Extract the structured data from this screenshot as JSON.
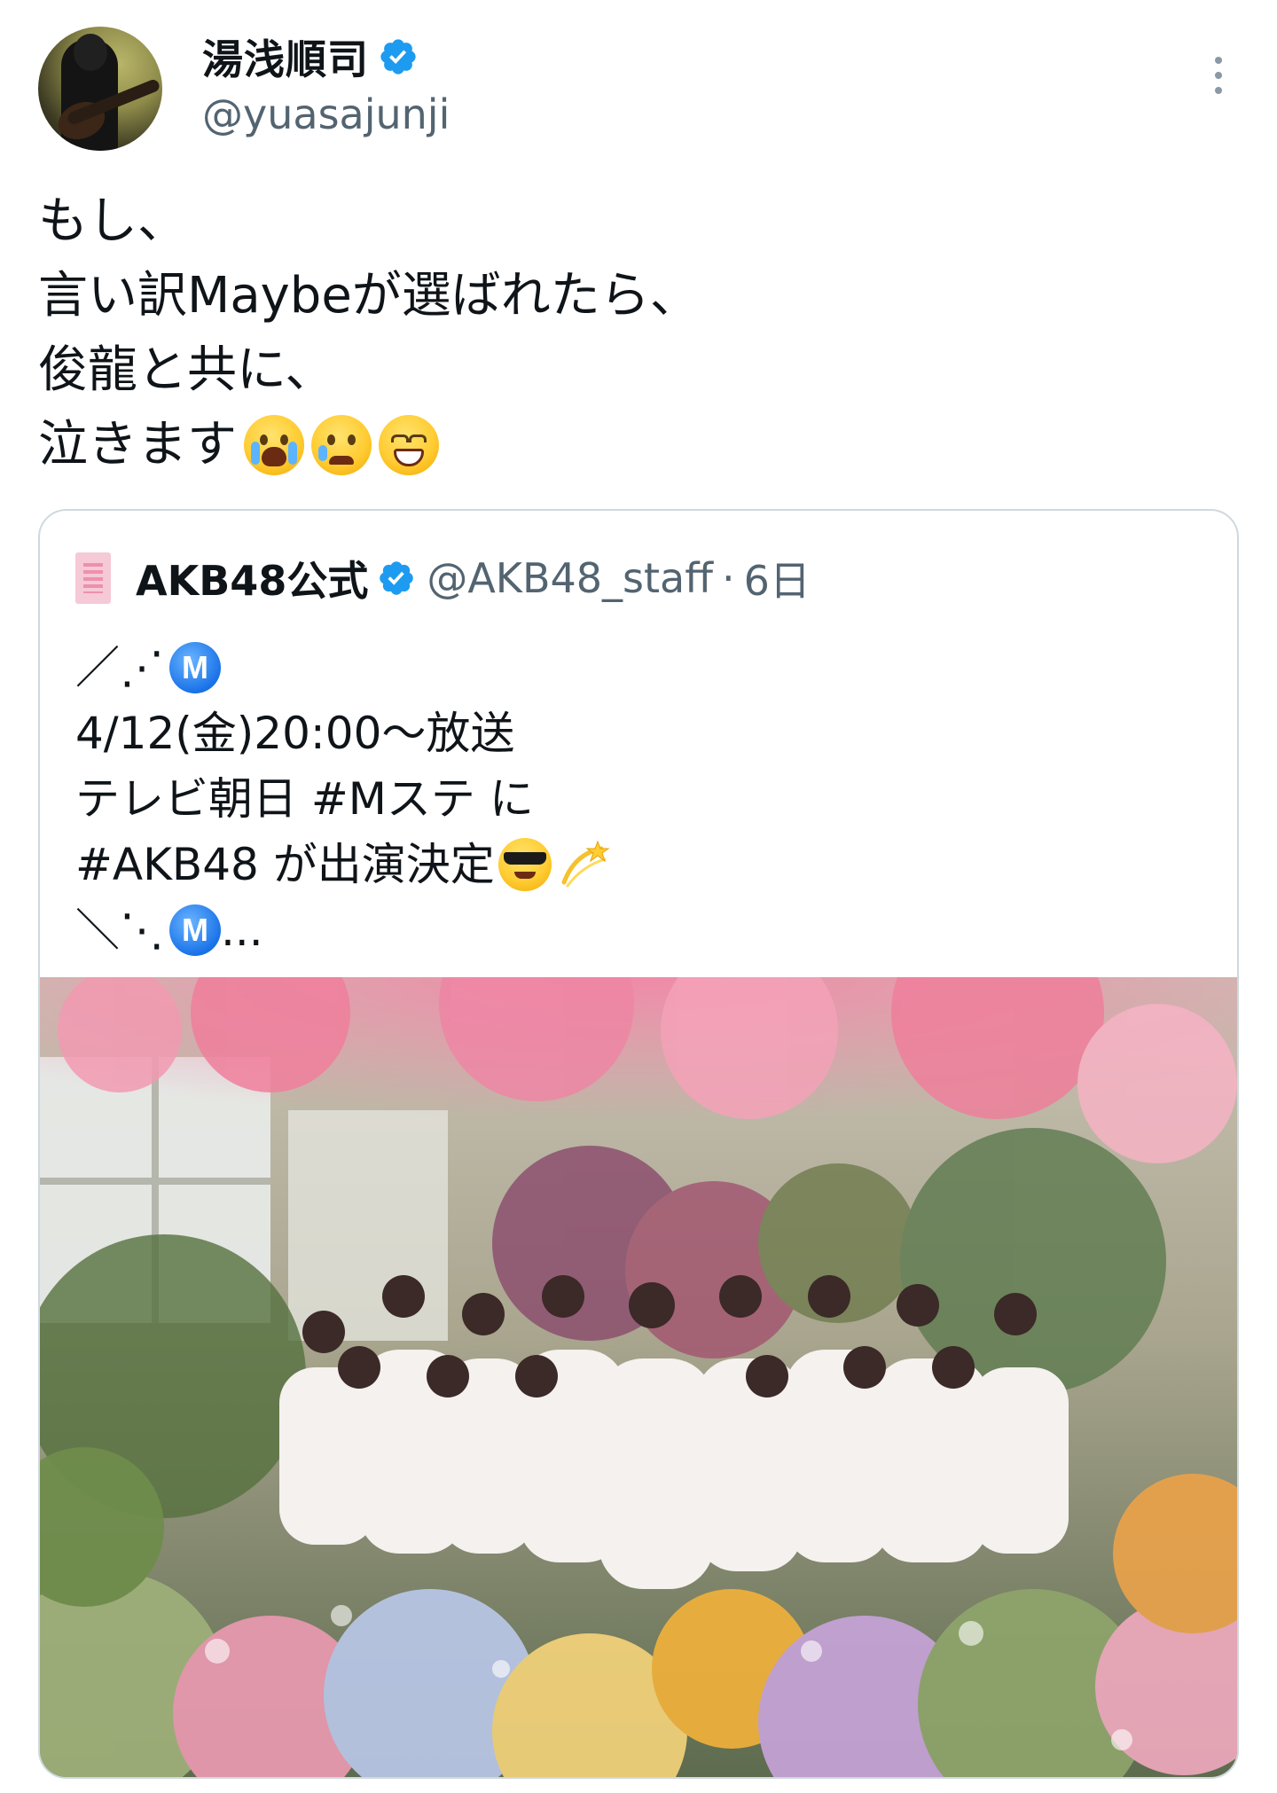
{
  "author": {
    "display_name": "湯浅順司",
    "handle": "@yuasajunji",
    "verified": true,
    "avatar_icon": "avatar-guitarist-photo"
  },
  "more_icon": "more-options-icon",
  "tweet": {
    "lines": [
      "もし、",
      "言い訳Maybeが選ばれたら、",
      "俊龍と共に、",
      "泣きます"
    ],
    "line4_emojis": [
      "loudly-crying-face",
      "crying-face",
      "grinning-squinting-face"
    ]
  },
  "quote": {
    "display_name": "AKB48公式",
    "handle": "@AKB48_staff",
    "separator": "·",
    "time": "6日",
    "verified": true,
    "logo_icon": "akb48-logo-icon",
    "lines": [
      "／⋰",
      "4/12(金)20:00〜放送",
      "テレビ朝日 #Mステ に",
      "#AKB48 が出演決定",
      "＼⋱",
      "..."
    ],
    "m_badge_text": "M",
    "line4_emojis": [
      "smiling-face-with-sunglasses",
      "dizzy"
    ],
    "image": {
      "description_icon": "group-photo-flowers"
    }
  },
  "colors": {
    "text": "#0f1419",
    "secondary": "#536471",
    "verified_blue": "#1d9bf0",
    "border": "#cfd9de"
  }
}
